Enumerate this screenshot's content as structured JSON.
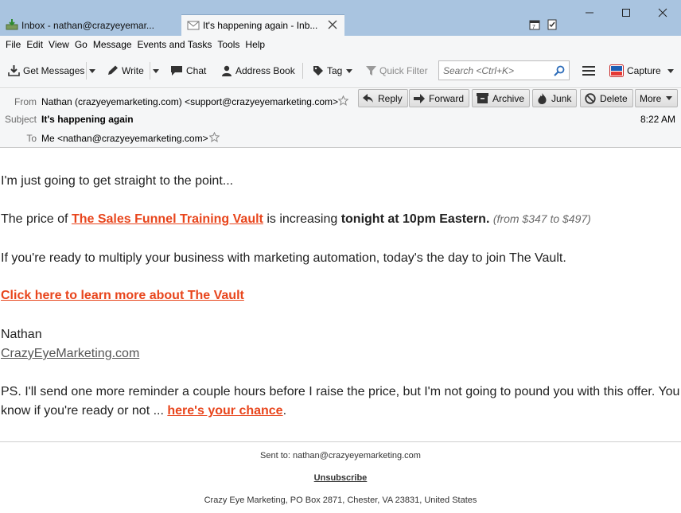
{
  "tabs": [
    {
      "title": "Inbox - nathan@crazyeyemar...",
      "icon": "inbox-download-icon"
    },
    {
      "title": "It's happening again - Inb...",
      "icon": "envelope-icon"
    }
  ],
  "menu": {
    "file": "File",
    "edit": "Edit",
    "view": "View",
    "go": "Go",
    "message": "Message",
    "events": "Events and Tasks",
    "tools": "Tools",
    "help": "Help"
  },
  "toolbar": {
    "get_messages": "Get Messages",
    "write": "Write",
    "chat": "Chat",
    "address_book": "Address Book",
    "tag": "Tag",
    "quick_filter": "Quick Filter",
    "search_placeholder": "Search <Ctrl+K>",
    "capture": "Capture"
  },
  "header": {
    "from_label": "From",
    "from_value": "Nathan (crazyeyemarketing.com) <support@crazyeyemarketing.com>",
    "subject_label": "Subject",
    "subject_value": "It's happening again",
    "to_label": "To",
    "to_value": "Me <nathan@crazyeyemarketing.com>",
    "time": "8:22 AM"
  },
  "actions": {
    "reply": "Reply",
    "forward": "Forward",
    "archive": "Archive",
    "junk": "Junk",
    "delete": "Delete",
    "more": "More"
  },
  "email": {
    "line1": "I'm just going to get straight to the point...",
    "price_pre": "The price of ",
    "price_link": "The Sales Funnel Training Vault",
    "price_mid": " is increasing ",
    "price_bold": "tonight at 10pm Eastern.",
    "price_note": "(from $347 to $497)",
    "line3": "If you're ready to multiply your business with marketing automation, today's the day to join The Vault.",
    "cta": "Click here to learn more about The Vault",
    "sign_name": "Nathan",
    "sign_site": "CrazyEyeMarketing.com",
    "ps_line1": "PS. I'll send one more reminder a couple hours before I raise the price, but I'm not going to pound you with this offer. You",
    "ps_line2_pre": "know if you're ready or not ... ",
    "ps_link": "here's your chance",
    "ps_end": "."
  },
  "footer": {
    "sent_to": "Sent to: nathan@crazyeyemarketing.com",
    "unsubscribe": "Unsubscribe",
    "address": "Crazy Eye Marketing, PO Box 2871, Chester, VA 23831, United States"
  },
  "colors": {
    "link": "#e8451c",
    "titlebar": "#a9c4e0",
    "chrome": "#f5f6f7"
  }
}
